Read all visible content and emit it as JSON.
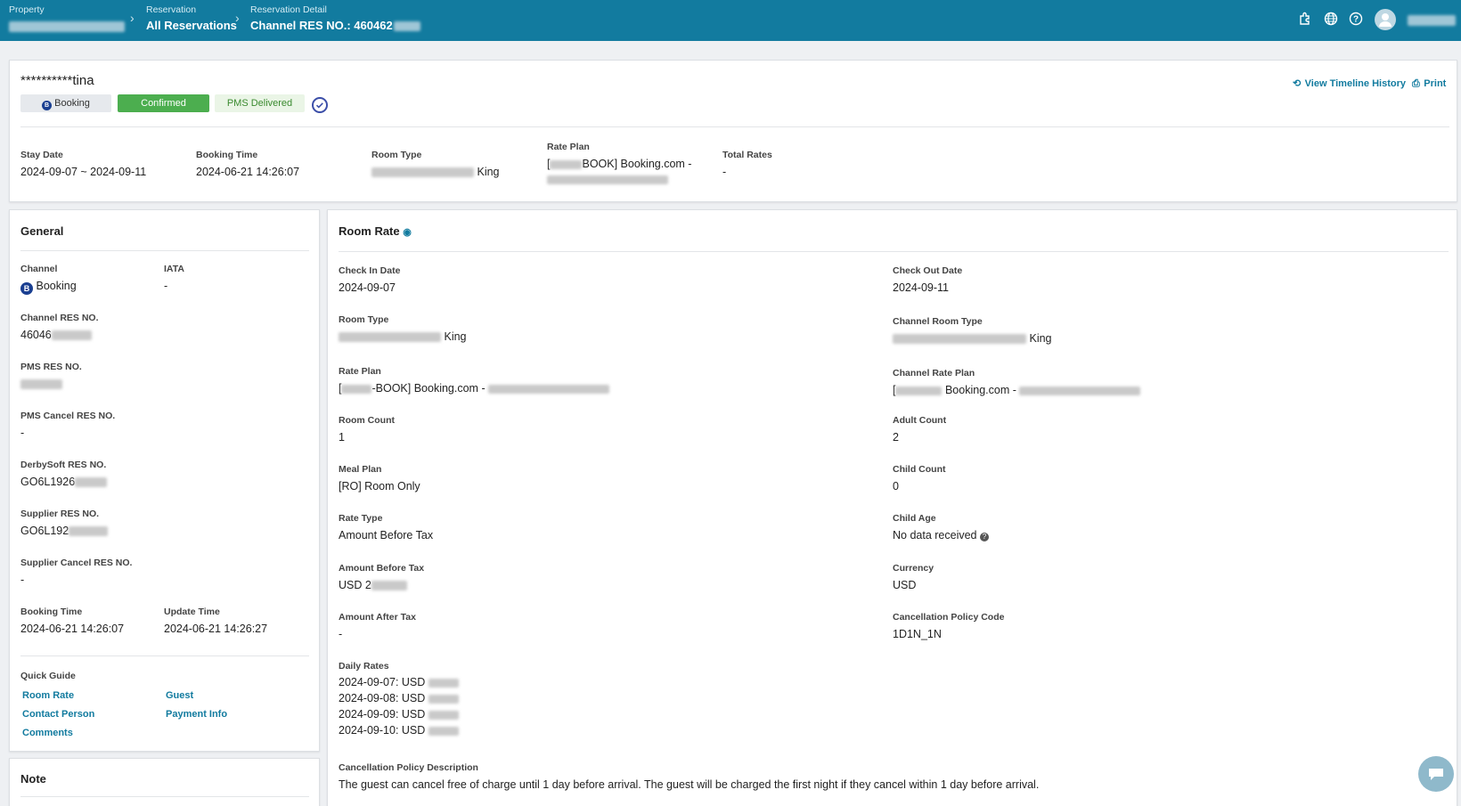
{
  "header": {
    "crumbs": [
      {
        "label": "Property",
        "value": ""
      },
      {
        "label": "Reservation",
        "value": "All Reservations"
      },
      {
        "label": "Reservation Detail",
        "value": "Channel RES NO.: 460462"
      }
    ]
  },
  "summary": {
    "guest_name": "**********tina",
    "badges": {
      "channel": "Booking",
      "status": "Confirmed",
      "pms": "PMS Delivered"
    },
    "actions": {
      "timeline": "View Timeline History",
      "print": "Print"
    },
    "stay_date_label": "Stay Date",
    "stay_date": "2024-09-07 ~ 2024-09-11",
    "booking_time_label": "Booking Time",
    "booking_time": "2024-06-21 14:26:07",
    "room_type_label": "Room Type",
    "room_type": "King",
    "rate_plan_label": "Rate Plan",
    "rate_plan_line1": "[",
    "rate_plan_line1b": "BOOK] Booking.com -",
    "total_rates_label": "Total Rates",
    "total_rates": "-"
  },
  "general": {
    "title": "General",
    "channel_label": "Channel",
    "channel": "Booking",
    "iata_label": "IATA",
    "iata": "-",
    "channel_res_label": "Channel RES NO.",
    "channel_res": "46046",
    "pms_res_label": "PMS RES NO.",
    "pms_cancel_label": "PMS Cancel RES NO.",
    "pms_cancel": "-",
    "derby_label": "DerbySoft RES NO.",
    "derby": "GO6L1926",
    "supplier_label": "Supplier RES NO.",
    "supplier": "GO6L192",
    "supplier_cancel_label": "Supplier Cancel RES NO.",
    "supplier_cancel": "-",
    "booking_time_label": "Booking Time",
    "booking_time": "2024-06-21 14:26:07",
    "update_time_label": "Update Time",
    "update_time": "2024-06-21 14:26:27",
    "quick_guide_label": "Quick Guide",
    "links": {
      "room_rate": "Room Rate",
      "guest": "Guest",
      "contact": "Contact Person",
      "payment": "Payment Info",
      "comments": "Comments"
    }
  },
  "note": {
    "title": "Note"
  },
  "room_rate": {
    "title": "Room Rate",
    "check_in_label": "Check In Date",
    "check_in": "2024-09-07",
    "check_out_label": "Check Out Date",
    "check_out": "2024-09-11",
    "room_type_label": "Room Type",
    "room_type": "King",
    "channel_room_type_label": "Channel Room Type",
    "channel_room_type": "King",
    "rate_plan_label": "Rate Plan",
    "rate_plan_a": "[",
    "rate_plan_b": "-BOOK] Booking.com - ",
    "channel_rate_plan_label": "Channel Rate Plan",
    "channel_rate_plan_a": "[",
    "channel_rate_plan_b": "Booking.com - ",
    "room_count_label": "Room Count",
    "room_count": "1",
    "adult_count_label": "Adult Count",
    "adult_count": "2",
    "meal_plan_label": "Meal Plan",
    "meal_plan": "[RO] Room Only",
    "child_count_label": "Child Count",
    "child_count": "0",
    "rate_type_label": "Rate Type",
    "rate_type": "Amount Before Tax",
    "child_age_label": "Child Age",
    "child_age": "No data received",
    "amount_before_label": "Amount Before Tax",
    "amount_before": "USD 2",
    "currency_label": "Currency",
    "currency": "USD",
    "amount_after_label": "Amount After Tax",
    "amount_after": "-",
    "cancel_code_label": "Cancellation Policy Code",
    "cancel_code": "1D1N_1N",
    "daily_rates_label": "Daily Rates",
    "daily_rates": [
      "2024-09-07: USD",
      "2024-09-08: USD",
      "2024-09-09: USD",
      "2024-09-10: USD"
    ],
    "cancel_desc_label": "Cancellation Policy Description",
    "cancel_desc": "The guest can cancel free of charge until 1 day before arrival. The guest will be charged the first night if they cancel within 1 day before arrival."
  }
}
